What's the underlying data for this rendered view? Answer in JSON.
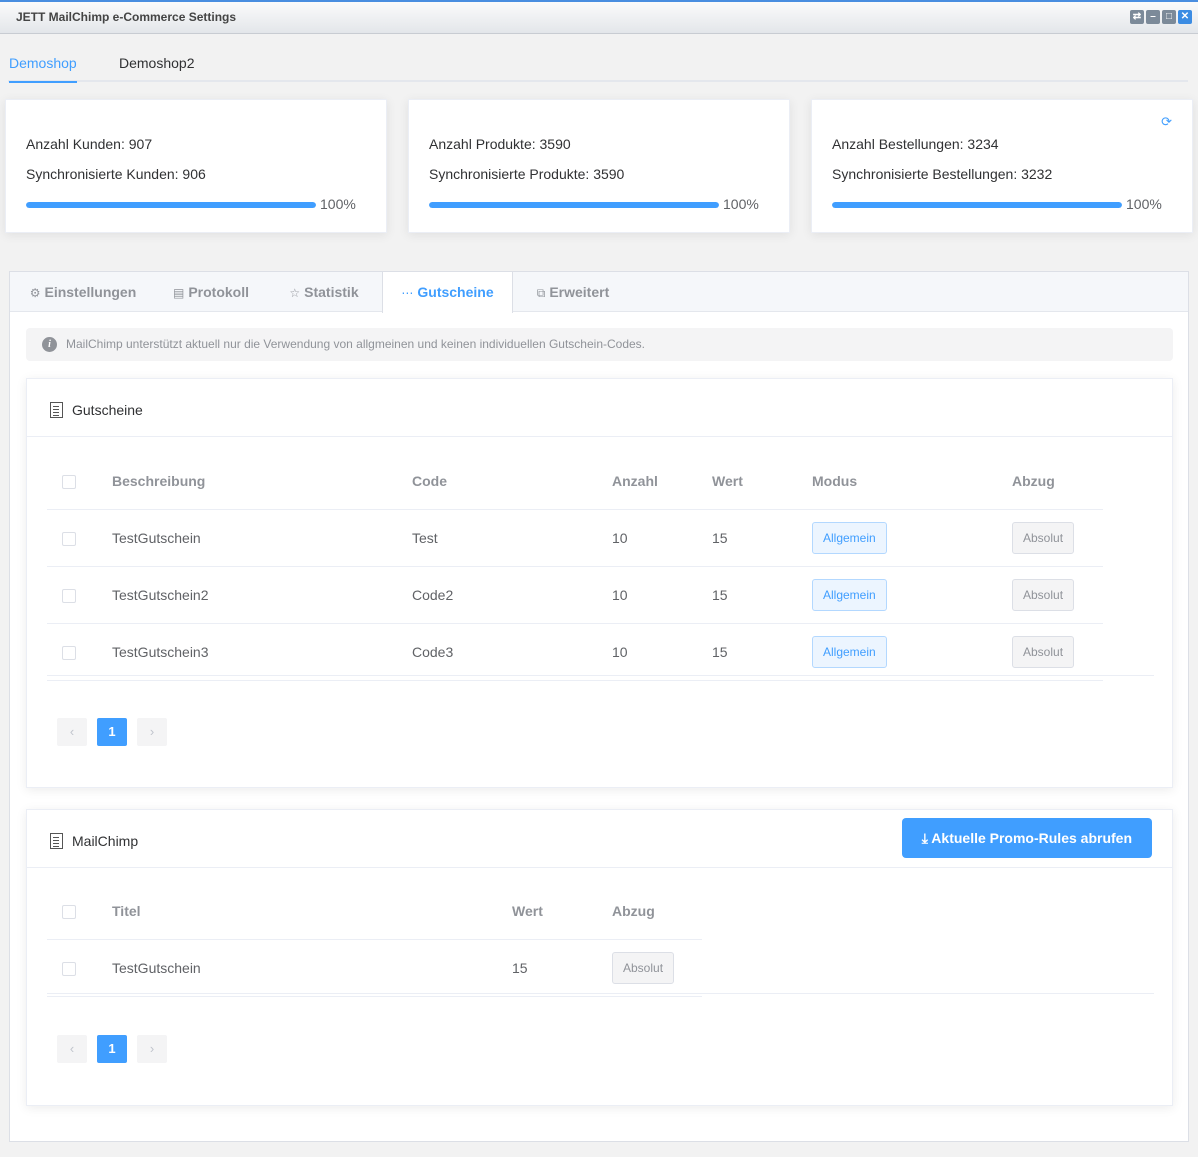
{
  "window": {
    "title": "JETT MailChimp e-Commerce Settings",
    "buttons": [
      "⇄",
      "–",
      "□",
      "✕"
    ]
  },
  "shop_tabs": [
    {
      "label": "Demoshop",
      "active": true
    },
    {
      "label": "Demoshop2",
      "active": false
    }
  ],
  "stats": [
    {
      "line1": "Anzahl Kunden: 907",
      "line2": "Synchronisierte Kunden: 906",
      "progress_pct": 100,
      "progress_label": "100%"
    },
    {
      "line1": "Anzahl Produkte: 3590",
      "line2": "Synchronisierte Produkte: 3590",
      "progress_pct": 100,
      "progress_label": "100%"
    },
    {
      "line1": "Anzahl Bestellungen: 3234",
      "line2": "Synchronisierte Bestellungen: 3232",
      "progress_pct": 100,
      "progress_label": "100%",
      "has_refresh_icon": true
    }
  ],
  "tabs": [
    {
      "label": "Einstellungen",
      "icon": "gear-icon",
      "glyph": "⚙",
      "active": false
    },
    {
      "label": "Protokoll",
      "icon": "document-icon",
      "glyph": "▤",
      "active": false
    },
    {
      "label": "Statistik",
      "icon": "star-icon",
      "glyph": "☆",
      "active": false
    },
    {
      "label": "Gutscheine",
      "icon": "more-icon",
      "glyph": "⋯",
      "active": true
    },
    {
      "label": "Erweitert",
      "icon": "extend-icon",
      "glyph": "⧉",
      "active": false
    }
  ],
  "alert": {
    "text": "MailChimp unterstützt aktuell nur die Verwendung von allgmeinen und keinen individuellen Gutschein-Codes."
  },
  "gutscheine": {
    "title": "Gutscheine",
    "columns": [
      "Beschreibung",
      "Code",
      "Anzahl",
      "Wert",
      "Modus",
      "Abzug"
    ],
    "rows": [
      {
        "beschreibung": "TestGutschein",
        "code": "Test",
        "anzahl": "10",
        "wert": "15",
        "modus": "Allgemein",
        "abzug": "Absolut"
      },
      {
        "beschreibung": "TestGutschein2",
        "code": "Code2",
        "anzahl": "10",
        "wert": "15",
        "modus": "Allgemein",
        "abzug": "Absolut"
      },
      {
        "beschreibung": "TestGutschein3",
        "code": "Code3",
        "anzahl": "10",
        "wert": "15",
        "modus": "Allgemein",
        "abzug": "Absolut"
      }
    ],
    "pager": {
      "prev": "‹",
      "current": "1",
      "next": "›"
    }
  },
  "mailchimp": {
    "title": "MailChimp",
    "button_label": "Aktuelle Promo-Rules abrufen",
    "columns": [
      "Titel",
      "Wert",
      "Abzug"
    ],
    "rows": [
      {
        "titel": "TestGutschein",
        "wert": "15",
        "abzug": "Absolut"
      }
    ],
    "pager": {
      "prev": "‹",
      "current": "1",
      "next": "›"
    }
  }
}
